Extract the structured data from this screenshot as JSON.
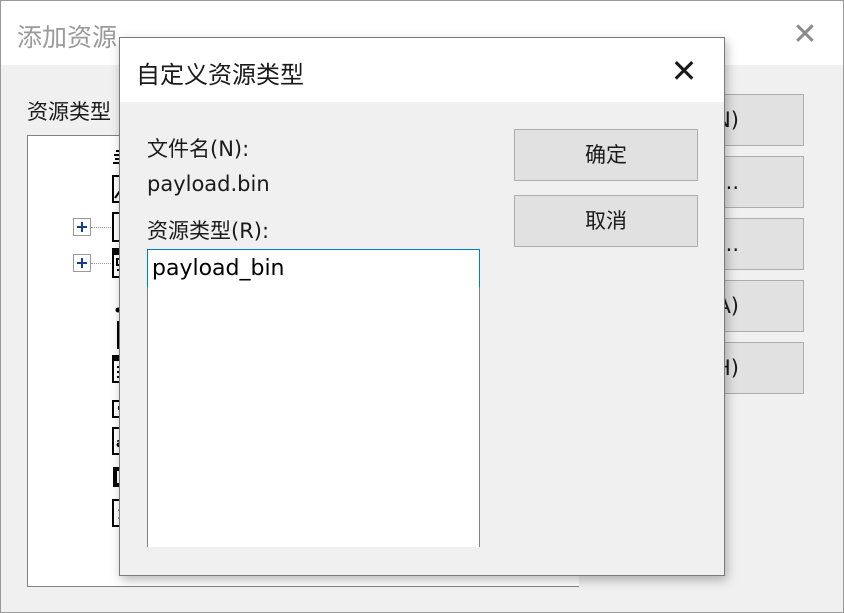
{
  "background_dialog": {
    "title": "添加资源",
    "close_glyph": "✕",
    "tree_label": "资源类型",
    "tree_icons": [
      "accelerator-icon",
      "bitmap-icon",
      "cursor-icon",
      "dialog-icon",
      "dialog-bar-icon",
      "html-icon",
      "menu-icon",
      "toolbar-icon",
      "string-table-icon",
      "toolbar-bitmap-icon",
      "version-icon"
    ],
    "button_fragments": [
      "N)",
      ")...",
      "C)...",
      "A)",
      "H)"
    ]
  },
  "custom_dialog": {
    "title": "自定义资源类型",
    "close_glyph": "✕",
    "filename_label": "文件名(N):",
    "filename_value": "payload.bin",
    "resource_type_label": "资源类型(R):",
    "resource_type_value": "payload_bin",
    "ok_label": "确定",
    "cancel_label": "取消"
  },
  "colors": {
    "focus_border": "#0078d7",
    "button_face": "#e1e1e1",
    "dialog_face": "#f0f0f0"
  }
}
